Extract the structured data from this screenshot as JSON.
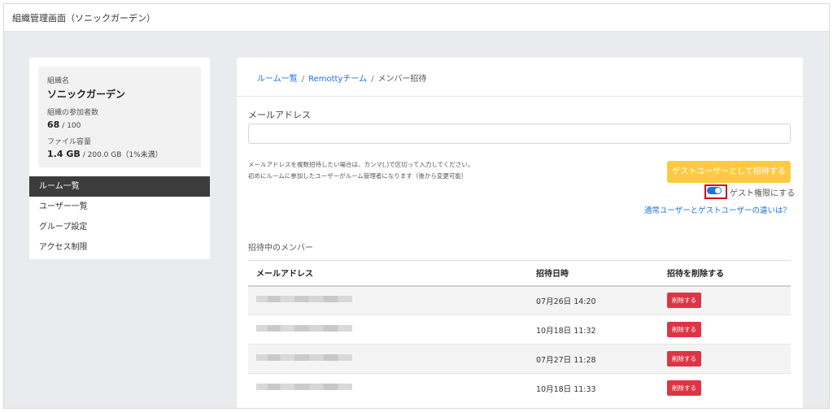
{
  "header": {
    "title": "組織管理画面（ソニックガーデン）"
  },
  "sidebar": {
    "org_name_label": "組織名",
    "org_name": "ソニックガーデン",
    "members_label": "組織の参加者数",
    "members_count": "68",
    "members_max": "/ 100",
    "storage_label": "ファイル容量",
    "storage_used": "1.4 GB",
    "storage_total": "/ 200.0 GB（1%未満）",
    "items": [
      {
        "label": "ルーム一覧",
        "active": true
      },
      {
        "label": "ユーザー一覧",
        "active": false
      },
      {
        "label": "グループ設定",
        "active": false
      },
      {
        "label": "アクセス制限",
        "active": false
      }
    ]
  },
  "breadcrumb": {
    "rooms": "ルーム一覧",
    "sep1": "/",
    "team": "Remottyチーム",
    "sep2": "/",
    "current": "メンバー招待"
  },
  "form": {
    "email_label": "メールアドレス",
    "email_value": "",
    "help_line1": "メールアドレスを複数招待したい場合は、カンマ(,)で区切って入力してください。",
    "help_line2": "初めにルームに参加したユーザーがルーム管理者になります（後から変更可能）",
    "invite_button": "ゲストユーザーとして招待する",
    "guest_toggle_label": "ゲスト権限にする",
    "guest_toggle_on": true,
    "diff_link": "通常ユーザーとゲストユーザーの違いは？"
  },
  "invited": {
    "section_title": "招待中のメンバー",
    "columns": [
      "メールアドレス",
      "招待日時",
      "招待を削除する"
    ],
    "rows": [
      {
        "date": "07月26日 14:20",
        "action": "削除する"
      },
      {
        "date": "10月18日 11:32",
        "action": "削除する"
      },
      {
        "date": "07月27日 11:28",
        "action": "削除する"
      },
      {
        "date": "10月18日 11:33",
        "action": "削除する"
      }
    ]
  },
  "colors": {
    "accent": "#1a73e8",
    "invite_button": "#ffc942",
    "delete_button": "#dc3545",
    "active_menu": "#3c3c3c",
    "highlight_border": "#d0021b"
  }
}
